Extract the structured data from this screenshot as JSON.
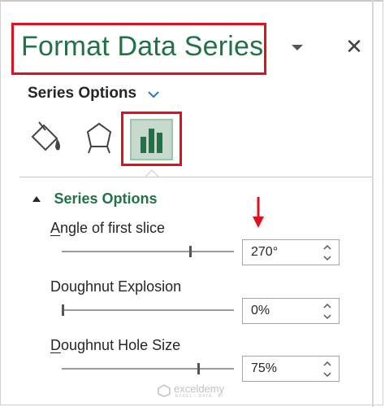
{
  "pane": {
    "title": "Format Data Series",
    "close_glyph": "✕",
    "icons": {
      "dropdown": "caret-down-icon",
      "close": "close-icon"
    }
  },
  "series_options_menu": {
    "label": "Series Options",
    "icon": "chevron-down-icon"
  },
  "tabs": [
    {
      "name": "fill-line",
      "icon": "paint-bucket-icon",
      "selected": false
    },
    {
      "name": "effects",
      "icon": "pentagon-icon",
      "selected": false
    },
    {
      "name": "series-options",
      "icon": "bar-chart-icon",
      "selected": true
    }
  ],
  "section": {
    "title": "Series Options",
    "expanded": true,
    "fields": [
      {
        "label": "Angle of first slice",
        "underline_char": "A",
        "value": "270°",
        "slider_fraction": 0.75
      },
      {
        "label": "Doughnut Explosion",
        "underline_char": "",
        "value": "0%",
        "slider_fraction": 0.0
      },
      {
        "label": "Doughnut Hole Size",
        "underline_char": "D",
        "value": "75%",
        "slider_fraction": 0.8
      }
    ]
  },
  "watermark": {
    "name": "exceldemy",
    "tagline": "EXCEL · DATA · BI"
  },
  "colors": {
    "accent_green": "#217346",
    "highlight_red": "#e0101e",
    "selected_tab_bg": "#c6d9cc"
  }
}
